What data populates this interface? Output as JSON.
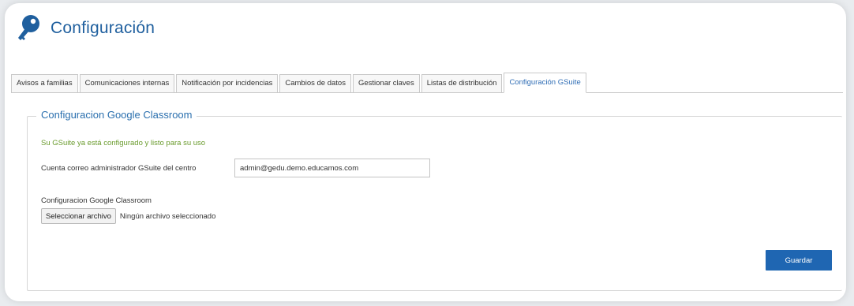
{
  "header": {
    "title": "Configuración",
    "icon": "key-icon",
    "accent": "#1f5f9e"
  },
  "tabs": [
    {
      "label": "Avisos a familias",
      "active": false
    },
    {
      "label": "Comunicaciones internas",
      "active": false
    },
    {
      "label": "Notificación por incidencias",
      "active": false
    },
    {
      "label": "Cambios de datos",
      "active": false
    },
    {
      "label": "Gestionar claves",
      "active": false
    },
    {
      "label": "Listas de distribución",
      "active": false
    },
    {
      "label": "Configuración GSuite",
      "active": true
    }
  ],
  "panel": {
    "legend": "Configuracion Google Classroom",
    "success_message": "Su GSuite ya está configurado y listo para su uso",
    "email_label": "Cuenta correo administrador GSuite del centro",
    "email_value": "admin@gedu.demo.educamos.com",
    "file_label": "Configuracion Google Classroom",
    "file_button": "Seleccionar archivo",
    "file_status": "Ningún archivo seleccionado",
    "save_button": "Guardar",
    "save_color": "#1f66b2",
    "success_color": "#6a9b2d"
  }
}
